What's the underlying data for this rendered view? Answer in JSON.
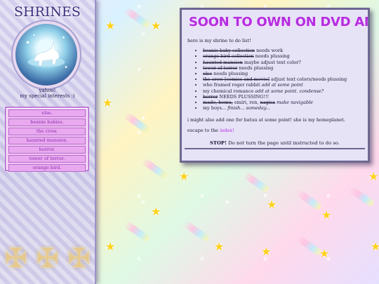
{
  "sidebar": {
    "title": "SHRINES",
    "yahoo": "yahoo!",
    "special": "my special interests :)",
    "nav": [
      "else.",
      "beanie babies.",
      "the crow.",
      "haunted mansion.",
      "horror.",
      "tower of terror.",
      "orange bird."
    ]
  },
  "panel": {
    "title": "SOON TO OWN ON DVD AND",
    "intro": "here is my shrine to do list!",
    "items": [
      {
        "struck": "beanie baby collection",
        "rest": " needs work"
      },
      {
        "struck": "orange bird collection",
        "rest": " needs plussing"
      },
      {
        "struck": "haunted mansion",
        "rest": " maybe adjust text color?"
      },
      {
        "struck": "tower of terror",
        "rest": " needs plussing"
      },
      {
        "struck": "else",
        "rest": " needs plussing"
      },
      {
        "struck": "the crow [comics and movie]",
        "rest": " adjust text colors/needs plussing"
      },
      {
        "plain": "who framed roger rabbit ",
        "italic": "add at some point"
      },
      {
        "plain": "my chemical romance ",
        "italic": "add at some point. condense?"
      },
      {
        "struck": "horror",
        "rest": " NEEDS PLUSSING!!!"
      },
      {
        "struck": "mado, homu,",
        "mid": " emiri, ren, ",
        "struck2": "nagisa",
        "italic": " make navigable"
      },
      {
        "plain": "my boys... ",
        "italic": "finish... someday..."
      }
    ],
    "note_pre": "i might also add one for batuu at some point! she ",
    "note_em": "is",
    "note_post": " my homeplanet.",
    "escape_pre": "escape to the ",
    "escape_link": "index!",
    "stop_bold": "STOP!",
    "stop_rest": "  Do not turn the page until instructed to do so."
  }
}
